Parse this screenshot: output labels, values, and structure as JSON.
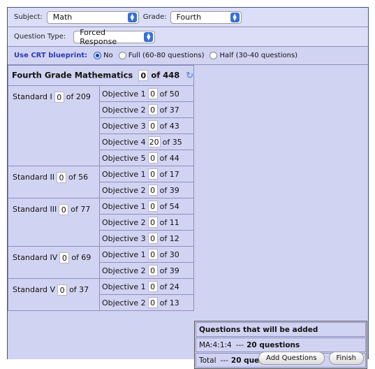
{
  "filters": {
    "subject_label": "Subject:",
    "subject_value": "Math",
    "grade_label": "Grade:",
    "grade_value": "Fourth",
    "qtype_label": "Question Type:",
    "qtype_value": "Forced Response"
  },
  "crt": {
    "label": "Use CRT blueprint:",
    "options": [
      "No",
      "Full (60-80 questions)",
      "Half (30-40 questions)"
    ],
    "selected": "No"
  },
  "table": {
    "title": "Fourth Grade Mathematics",
    "title_value": "0",
    "title_total": "of 448",
    "standards": [
      {
        "label": "Standard I",
        "value": "0",
        "total": "of 209",
        "objectives": [
          {
            "label": "Objective 1",
            "value": "0",
            "total": "of 50"
          },
          {
            "label": "Objective 2",
            "value": "0",
            "total": "of 37"
          },
          {
            "label": "Objective 3",
            "value": "0",
            "total": "of 43"
          },
          {
            "label": "Objective 4",
            "value": "20",
            "total": "of 35"
          },
          {
            "label": "Objective 5",
            "value": "0",
            "total": "of 44"
          }
        ]
      },
      {
        "label": "Standard II",
        "value": "0",
        "total": "of 56",
        "objectives": [
          {
            "label": "Objective 1",
            "value": "0",
            "total": "of 17"
          },
          {
            "label": "Objective 2",
            "value": "0",
            "total": "of 39"
          }
        ]
      },
      {
        "label": "Standard III",
        "value": "0",
        "total": "of 77",
        "objectives": [
          {
            "label": "Objective 1",
            "value": "0",
            "total": "of 54"
          },
          {
            "label": "Objective 2",
            "value": "0",
            "total": "of 11"
          },
          {
            "label": "Objective 3",
            "value": "0",
            "total": "of 12"
          }
        ]
      },
      {
        "label": "Standard IV",
        "value": "0",
        "total": "of 69",
        "objectives": [
          {
            "label": "Objective 1",
            "value": "0",
            "total": "of 30"
          },
          {
            "label": "Objective 2",
            "value": "0",
            "total": "of 39"
          }
        ]
      },
      {
        "label": "Standard V",
        "value": "0",
        "total": "of 37",
        "objectives": [
          {
            "label": "Objective 1",
            "value": "0",
            "total": "of 24"
          },
          {
            "label": "Objective 2",
            "value": "0",
            "total": "of 13"
          }
        ]
      }
    ]
  },
  "summary": {
    "header": "Questions that will be added",
    "item_code": "MA:4:1:4",
    "item_sep": "---",
    "item_count": "20 questions",
    "total_label": "Total",
    "total_sep": "---",
    "total_count": "20 questions"
  },
  "buttons": {
    "add": "Add Questions",
    "finish": "Finish"
  },
  "icons": {
    "refresh": "refresh-icon",
    "select_arrows": "updown-arrows-icon"
  }
}
